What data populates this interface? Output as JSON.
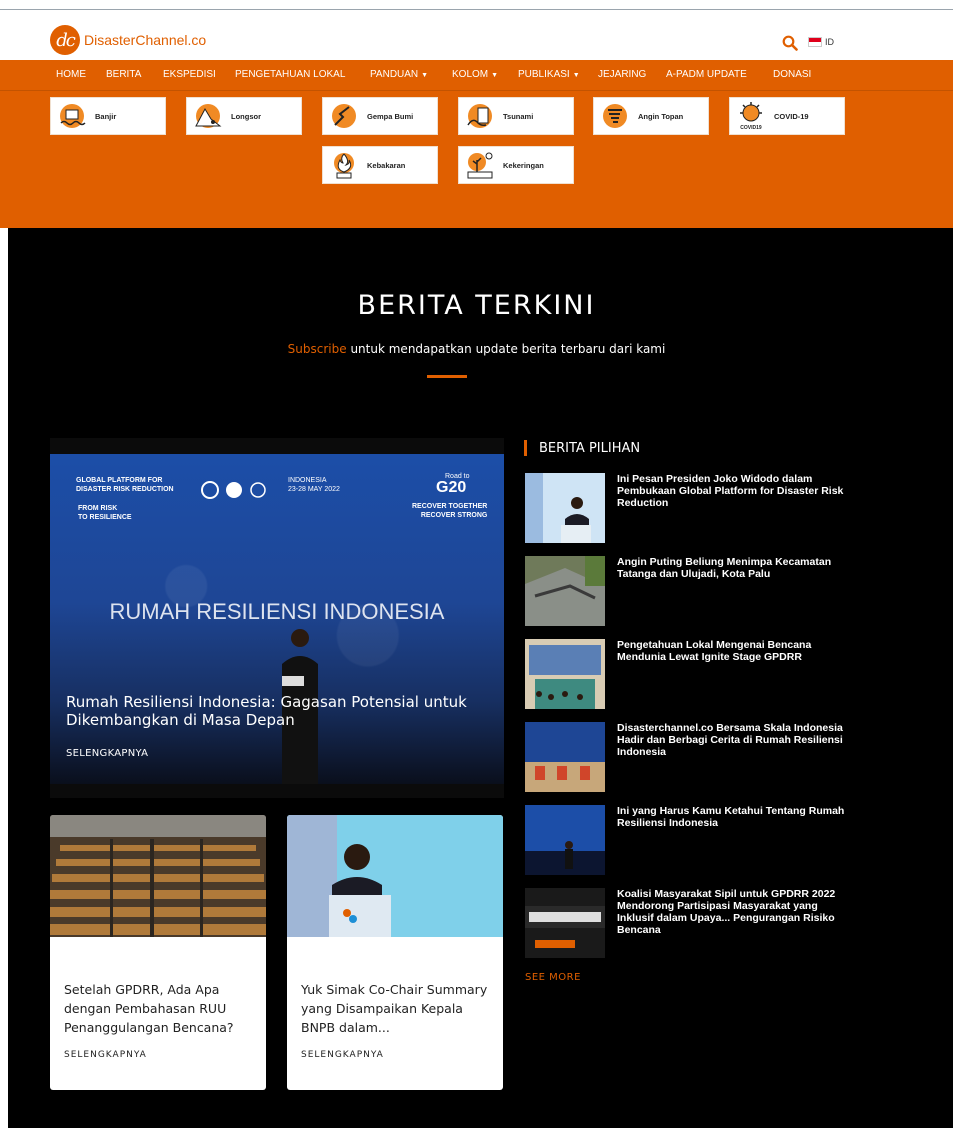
{
  "header": {
    "logo_mark": "dc",
    "logo_name": "DisasterChannel",
    "logo_tld": ".co",
    "lang": "ID",
    "accent": "#e05f00"
  },
  "nav": {
    "items": [
      {
        "label": "HOME"
      },
      {
        "label": "BERITA"
      },
      {
        "label": "EKSPEDISI"
      },
      {
        "label": "PENGETAHUAN LOKAL"
      },
      {
        "label": "PANDUAN",
        "dropdown": true
      },
      {
        "label": "KOLOM",
        "dropdown": true
      },
      {
        "label": "PUBLIKASI",
        "dropdown": true
      },
      {
        "label": "JEJARING"
      },
      {
        "label": "A-PADM UPDATE"
      },
      {
        "label": "DONASI"
      }
    ]
  },
  "categories": [
    {
      "label": "Banjir",
      "icon": "flood-icon"
    },
    {
      "label": "Longsor",
      "icon": "landslide-icon"
    },
    {
      "label": "Gempa Bumi",
      "icon": "earthquake-icon"
    },
    {
      "label": "Tsunami",
      "icon": "tsunami-icon"
    },
    {
      "label": "Angin Topan",
      "icon": "storm-icon"
    },
    {
      "label": "COVID-19",
      "icon": "virus-icon",
      "icon_text": "COVID19"
    },
    {
      "label": "Kebakaran",
      "icon": "fire-icon"
    },
    {
      "label": "Kekeringan",
      "icon": "drought-icon"
    }
  ],
  "section": {
    "title": "BERITA TERKINI",
    "subscribe": "Subscribe",
    "subtitle_rest": " untuk mendapatkan update berita terbaru dari kami"
  },
  "hero": {
    "banner_text": "RUMAH RESILIENSI INDONESIA",
    "banner_top_left": "GLOBAL PLATFORM FOR\nDISASTER RISK REDUCTION",
    "banner_slogan": "FROM RISK\nTO RESILIENCE",
    "banner_location": "INDONESIA\n23-28 MAY 2022",
    "banner_g20": "G20",
    "banner_road": "Road to",
    "banner_recover": "RECOVER TOGETHER\nRECOVER STRONG",
    "title": "Rumah Resiliensi Indonesia: Gagasan Potensial untuk Dikembangkan di Masa Depan",
    "more": "SELENGKAPNYA"
  },
  "cards": [
    {
      "title": "Setelah GPDRR, Ada Apa dengan Pembahasan RUU Penanggulangan Bencana?",
      "more": "SELENGKAPNYA"
    },
    {
      "title": "Yuk Simak Co-Chair Summary yang Disampaikan Kepala BNPB dalam...",
      "more": "SELENGKAPNYA"
    }
  ],
  "sidebar": {
    "heading": "BERITA PILIHAN",
    "items": [
      {
        "title": "Ini Pesan Presiden Joko Widodo dalam Pembukaan Global Platform for Disaster Risk Reduction"
      },
      {
        "title": "Angin Puting Beliung Menimpa Kecamatan Tatanga dan Ulujadi, Kota Palu"
      },
      {
        "title": "Pengetahuan Lokal Mengenai Bencana Mendunia Lewat Ignite Stage GPDRR"
      },
      {
        "title": "Disasterchannel.co Bersama Skala Indonesia Hadir dan Berbagi Cerita di Rumah Resiliensi Indonesia"
      },
      {
        "title": "Ini yang Harus Kamu Ketahui Tentang Rumah Resiliensi Indonesia"
      },
      {
        "title": "Koalisi Masyarakat Sipil untuk GPDRR 2022 Mendorong Partisipasi Masyarakat yang Inklusif dalam Upaya... Pengurangan Risiko Bencana"
      }
    ],
    "see_more": "SEE MORE"
  }
}
